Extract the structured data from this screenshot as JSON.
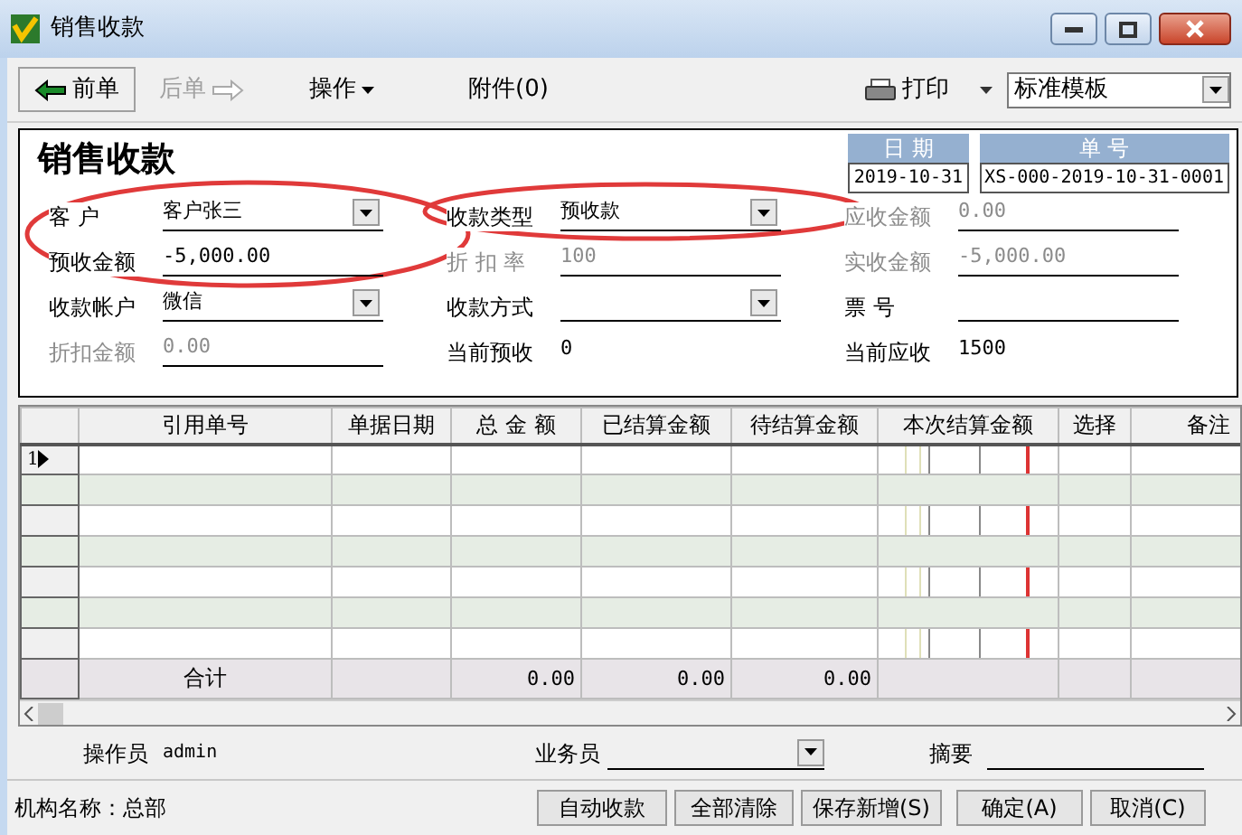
{
  "window": {
    "title": "销售收款"
  },
  "toolbar": [
    {
      "label": "前单",
      "kind": "prev",
      "disabled": false
    },
    {
      "label": "后单",
      "kind": "next",
      "disabled": true
    },
    {
      "label": "操作",
      "kind": "menu",
      "disabled": false
    },
    {
      "label": "附件(0)",
      "kind": "plain",
      "disabled": false
    },
    {
      "label": "打印",
      "kind": "print",
      "disabled": false
    }
  ],
  "template": {
    "value": "标准模板"
  },
  "form": {
    "title": "销售收款",
    "date": {
      "label": "日 期",
      "value": "2019-10-31"
    },
    "number": {
      "label": "单 号",
      "value": "XS-000-2019-10-31-0001"
    },
    "fields": [
      {
        "label": "客 户",
        "value": "客户张三",
        "kind": "dropdown",
        "disabled": false,
        "circled": true
      },
      {
        "label": "收款类型",
        "value": "预收款",
        "kind": "dropdown",
        "disabled": false,
        "circled": true
      },
      {
        "label": "应收金额",
        "value": "0.00",
        "kind": "input",
        "disabled": true,
        "circled": false
      },
      {
        "label": "预收金额",
        "value": "-5,000.00",
        "kind": "input",
        "disabled": false,
        "circled": true
      },
      {
        "label": "折 扣 率",
        "value": "100",
        "kind": "input",
        "disabled": true,
        "circled": false
      },
      {
        "label": "实收金额",
        "value": "-5,000.00",
        "kind": "input",
        "disabled": true,
        "circled": false
      },
      {
        "label": "收款帐户",
        "value": "微信",
        "kind": "dropdown",
        "disabled": false,
        "circled": false
      },
      {
        "label": "收款方式",
        "kind": "dropdown",
        "disabled": false,
        "circled": false
      },
      {
        "label": "票 号",
        "kind": "input",
        "disabled": false,
        "circled": false
      },
      {
        "label": "折扣金额",
        "value": "0.00",
        "kind": "input",
        "disabled": true,
        "circled": false
      },
      {
        "label": "当前预收",
        "value": "0",
        "kind": "readout",
        "disabled": false,
        "circled": false
      },
      {
        "label": "当前应收",
        "value": "1500",
        "kind": "readout",
        "disabled": false,
        "circled": false
      }
    ]
  },
  "table": {
    "columns": [
      "引用单号",
      "单据日期",
      "总 金 额",
      "已结算金额",
      "待结算金额",
      "本次结算金额",
      "选择",
      "备注"
    ],
    "rows": [
      {
        "number": "1",
        "current": true
      },
      {
        "current": false
      },
      {
        "current": false
      },
      {
        "current": false
      },
      {
        "current": false
      },
      {
        "current": false
      },
      {
        "current": false
      }
    ],
    "totals": {
      "label": "合计",
      "total_amount": "0.00",
      "settled_amount": "0.00",
      "pending_amount": "0.00"
    }
  },
  "footer": {
    "operator": {
      "label": "操作员",
      "value": "admin"
    },
    "salesperson": {
      "label": "业务员"
    },
    "summary": {
      "label": "摘要"
    }
  },
  "status_bar": {
    "text": "机构名称：总部"
  },
  "buttons": [
    "自动收款",
    "全部清除",
    "保存新增(S)",
    "确定(A)",
    "取消(C)"
  ]
}
